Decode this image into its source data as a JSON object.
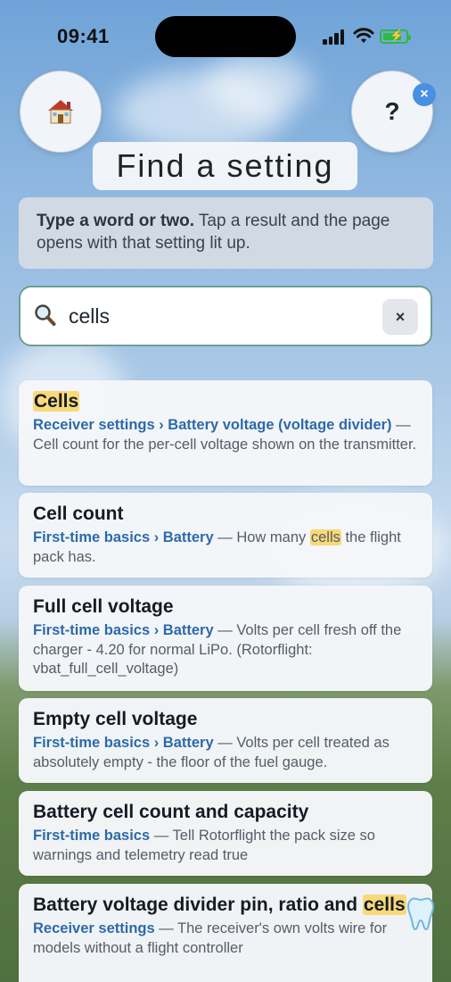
{
  "status": {
    "time": "09:41"
  },
  "header": {
    "home_icon": "house-emoji",
    "help_label": "?",
    "close_label": "×",
    "title": "Find a setting"
  },
  "hint": {
    "bold": "Type a word or two.",
    "rest": " Tap a result and the page opens with that setting lit up."
  },
  "search": {
    "icon": "magnifier-icon",
    "value": "cells",
    "clear_label": "×"
  },
  "results": [
    {
      "title_hl": "Cells",
      "path": "Receiver settings › Battery voltage (voltage divider)",
      "desc": " — Cell count for the per-cell voltage shown on the transmitter."
    },
    {
      "title": "Cell count",
      "path": "First-time basics › Battery",
      "desc_pre": " — How many ",
      "desc_hl": "cells",
      "desc_post": " the flight pack has."
    },
    {
      "title": "Full cell voltage",
      "path": "First-time basics › Battery",
      "desc": " — Volts per cell fresh off the charger - 4.20 for normal LiPo. (Rotorflight: vbat_full_cell_voltage)"
    },
    {
      "title": "Empty cell voltage",
      "path": "First-time basics › Battery",
      "desc": " — Volts per cell treated as absolutely empty - the floor of the fuel gauge."
    },
    {
      "title": "Battery cell count and capacity",
      "path": "First-time basics",
      "desc": " — Tell Rotorflight the pack size so warnings and telemetry read true"
    },
    {
      "title_pre": "Battery voltage divider pin, ratio and ",
      "title_hl": "cells",
      "path": "Receiver settings",
      "desc": " — The receiver's own volts wire for models without a flight controller"
    }
  ],
  "floating": {
    "icon": "tooth-icon"
  },
  "colors": {
    "accent": "#2c6aa8",
    "highlight": "#f7d978",
    "search_border": "#6f9f96",
    "badge": "#4a90e2"
  }
}
